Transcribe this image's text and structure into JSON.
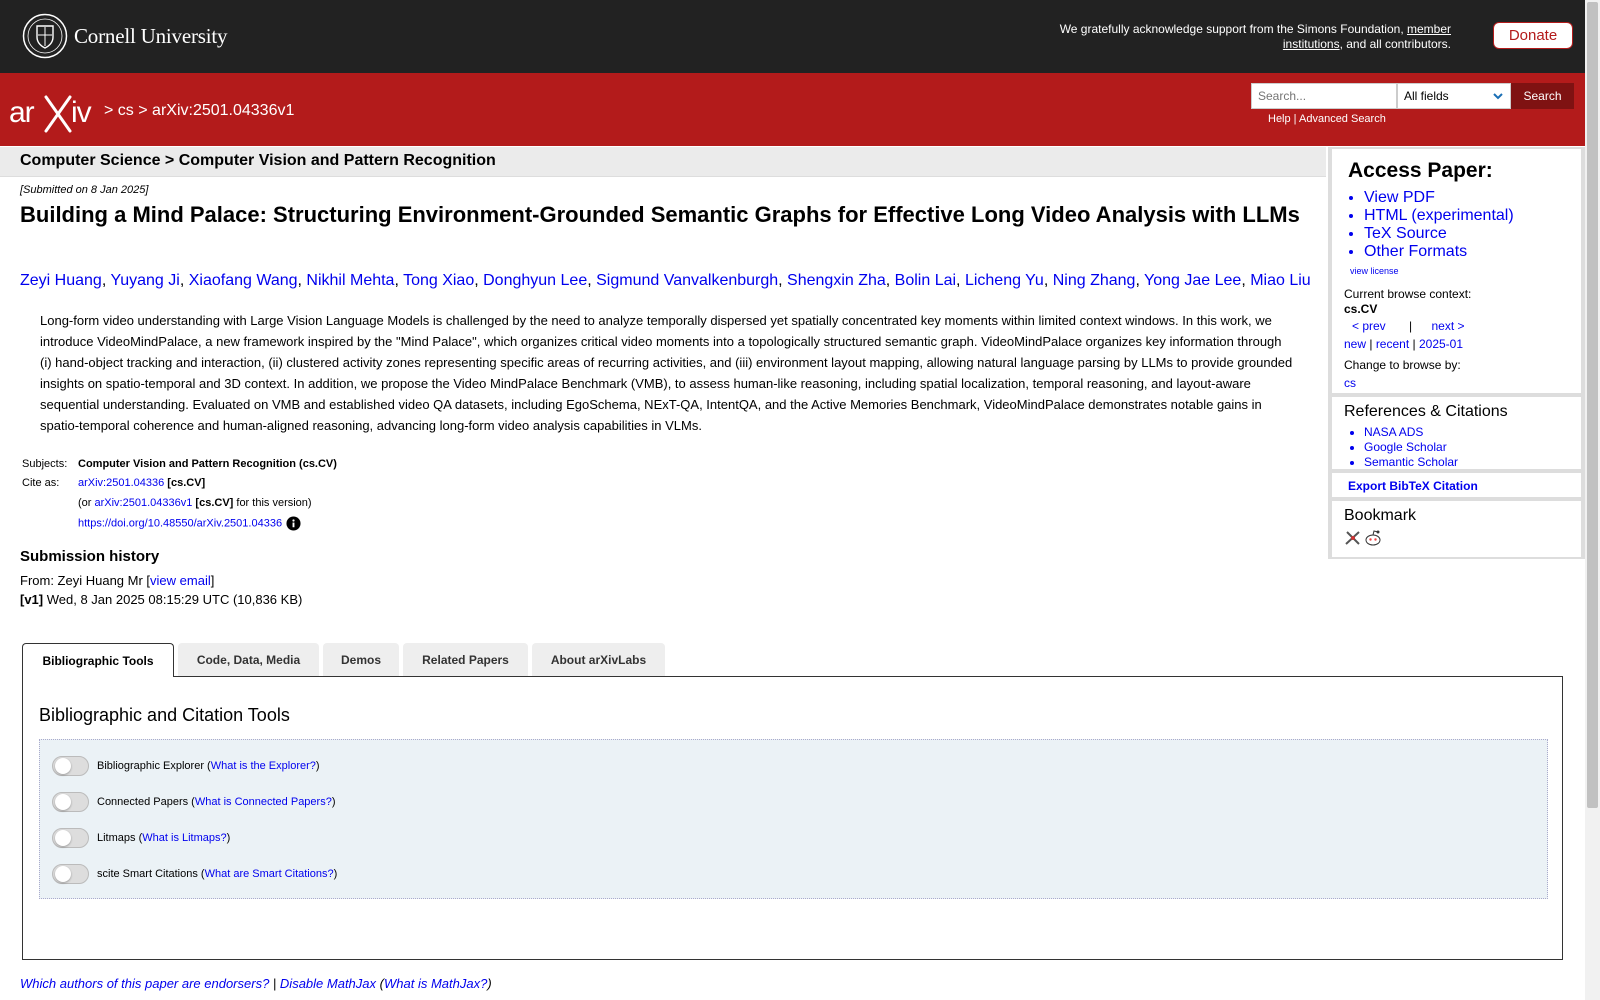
{
  "header": {
    "institution": "Cornell University",
    "support_pre": "We gratefully acknowledge support from the Simons Foundation, ",
    "support_link1": "member",
    "support_link2": "institutions",
    "support_post": ", and all contributors.",
    "donate_label": "Donate"
  },
  "nav": {
    "sep1": ">",
    "crumb_cs": "cs",
    "sep2": ">",
    "crumb_id": "arXiv:2501.04336v1",
    "search_placeholder": "Search...",
    "search_field": "All fields",
    "search_button": "Search",
    "help": "Help",
    "help_sep": " | ",
    "advanced": "Advanced Search"
  },
  "subject_header": "Computer Science > Computer Vision and Pattern Recognition",
  "paper": {
    "submitted": "[Submitted on 8 Jan 2025]",
    "title": "Building a Mind Palace: Structuring Environment-Grounded Semantic Graphs for Effective Long Video Analysis with LLMs",
    "authors": [
      "Zeyi Huang",
      "Yuyang Ji",
      "Xiaofang Wang",
      "Nikhil Mehta",
      "Tong Xiao",
      "Donghyun Lee",
      "Sigmund Vanvalkenburgh",
      "Shengxin Zha",
      "Bolin Lai",
      "Licheng Yu",
      "Ning Zhang",
      "Yong Jae Lee",
      "Miao Liu"
    ],
    "abstract": "Long-form video understanding with Large Vision Language Models is challenged by the need to analyze temporally dispersed yet spatially concentrated key moments within limited context windows. In this work, we introduce VideoMindPalace, a new framework inspired by the \"Mind Palace\", which organizes critical video moments into a topologically structured semantic graph. VideoMindPalace organizes key information through (i) hand-object tracking and interaction, (ii) clustered activity zones representing specific areas of recurring activities, and (iii) environment layout mapping, allowing natural language parsing by LLMs to provide grounded insights on spatio-temporal and 3D context. In addition, we propose the Video MindPalace Benchmark (VMB), to assess human-like reasoning, including spatial localization, temporal reasoning, and layout-aware sequential understanding. Evaluated on VMB and established video QA datasets, including EgoSchema, NExT-QA, IntentQA, and the Active Memories Benchmark, VideoMindPalace demonstrates notable gains in spatio-temporal coherence and human-aligned reasoning, advancing long-form video analysis capabilities in VLMs."
  },
  "meta": {
    "subjects_label": "Subjects:",
    "subjects_value": "Computer Vision and Pattern Recognition (cs.CV)",
    "cite_label": "Cite as:",
    "cite_id": "arXiv:2501.04336",
    "cite_cat": " [cs.CV]",
    "or_pre": "(or ",
    "or_id": "arXiv:2501.04336v1",
    "or_cat": " [cs.CV]",
    "or_post": " for this version)",
    "doi": "https://doi.org/10.48550/arXiv.2501.04336"
  },
  "history": {
    "heading": "Submission history",
    "from_pre": "From: Zeyi Huang Mr [",
    "view_email": "view email",
    "from_post": "]",
    "v1_label": "[v1]",
    "v1_text": " Wed, 8 Jan 2025 08:15:29 UTC (10,836 KB)"
  },
  "tabs": [
    "Bibliographic Tools",
    "Code, Data, Media",
    "Demos",
    "Related Papers",
    "About arXivLabs"
  ],
  "tools": {
    "heading": "Bibliographic and Citation Tools",
    "items": [
      {
        "label": "Bibliographic Explorer",
        "help": "What is the Explorer?"
      },
      {
        "label": "Connected Papers",
        "help": "What is Connected Papers?"
      },
      {
        "label": "Litmaps",
        "help": "What is Litmaps?"
      },
      {
        "label": "scite Smart Citations",
        "help": "What are Smart Citations?"
      }
    ]
  },
  "footer": {
    "endorsers": "Which authors of this paper are endorsers?",
    "sep": " | ",
    "disable_mathjax": "Disable MathJax",
    "paren_open": " (",
    "what_mathjax": "What is MathJax?",
    "paren_close": ")"
  },
  "sidebar": {
    "access_heading": "Access Paper:",
    "access_links": [
      "View PDF",
      "HTML (experimental)",
      "TeX Source",
      "Other Formats"
    ],
    "view_license": "view license",
    "context_label": "Current browse context:",
    "context_value": "cs.CV",
    "prev": "< prev",
    "pipe": "|",
    "next": "next >",
    "new": "new",
    "recent": "recent",
    "month": "2025-01",
    "sep": " | ",
    "browse_label": "Change to browse by:",
    "browse_cs": "cs",
    "refs_heading": "References & Citations",
    "refs": [
      "NASA ADS",
      "Google Scholar",
      "Semantic Scholar"
    ],
    "export_bibtex": "Export BibTeX Citation",
    "bookmark_heading": "Bookmark"
  },
  "colors": {
    "header_bg": "#222222",
    "arxiv_red": "#b31b1b",
    "link": "#0000ee",
    "tools_bg": "#ebf2f6"
  }
}
